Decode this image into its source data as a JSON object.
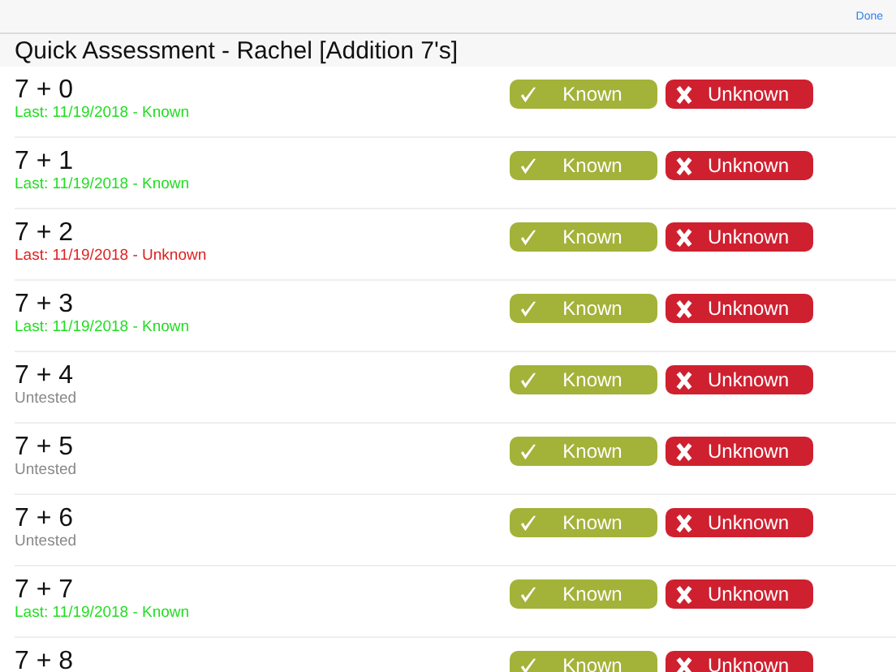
{
  "nav_bar": {
    "done_button": "Done"
  },
  "title": "Quick Assessment - Rachel [Addition 7's]",
  "rows": [
    {
      "problem": "7 + 0",
      "status": {
        "text": "Last: 11/19/2018 - Known",
        "kind": "known"
      },
      "known_button": "Known",
      "unknown_button": "Unknown"
    },
    {
      "problem": "7 + 1",
      "status": {
        "text": "Last: 11/19/2018 - Known",
        "kind": "known"
      },
      "known_button": "Known",
      "unknown_button": "Unknown"
    },
    {
      "problem": "7 + 2",
      "status": {
        "text": "Last: 11/19/2018 - Unknown",
        "kind": "unknown"
      },
      "known_button": "Known",
      "unknown_button": "Unknown"
    },
    {
      "problem": "7 + 3",
      "status": {
        "text": "Last: 11/19/2018 - Known",
        "kind": "known"
      },
      "known_button": "Known",
      "unknown_button": "Unknown"
    },
    {
      "problem": "7 + 4",
      "status": {
        "text": "Untested",
        "kind": "untested"
      },
      "known_button": "Known",
      "unknown_button": "Unknown"
    },
    {
      "problem": "7 + 5",
      "status": {
        "text": "Untested",
        "kind": "untested"
      },
      "known_button": "Known",
      "unknown_button": "Unknown"
    },
    {
      "problem": "7 + 6",
      "status": {
        "text": "Untested",
        "kind": "untested"
      },
      "known_button": "Known",
      "unknown_button": "Unknown"
    },
    {
      "problem": "7 + 7",
      "status": {
        "text": "Last: 11/19/2018 - Known",
        "kind": "known"
      },
      "known_button": "Known",
      "unknown_button": "Unknown"
    },
    {
      "problem": "7 + 8",
      "known_button": "Known",
      "unknown_button": "Unknown"
    }
  ]
}
